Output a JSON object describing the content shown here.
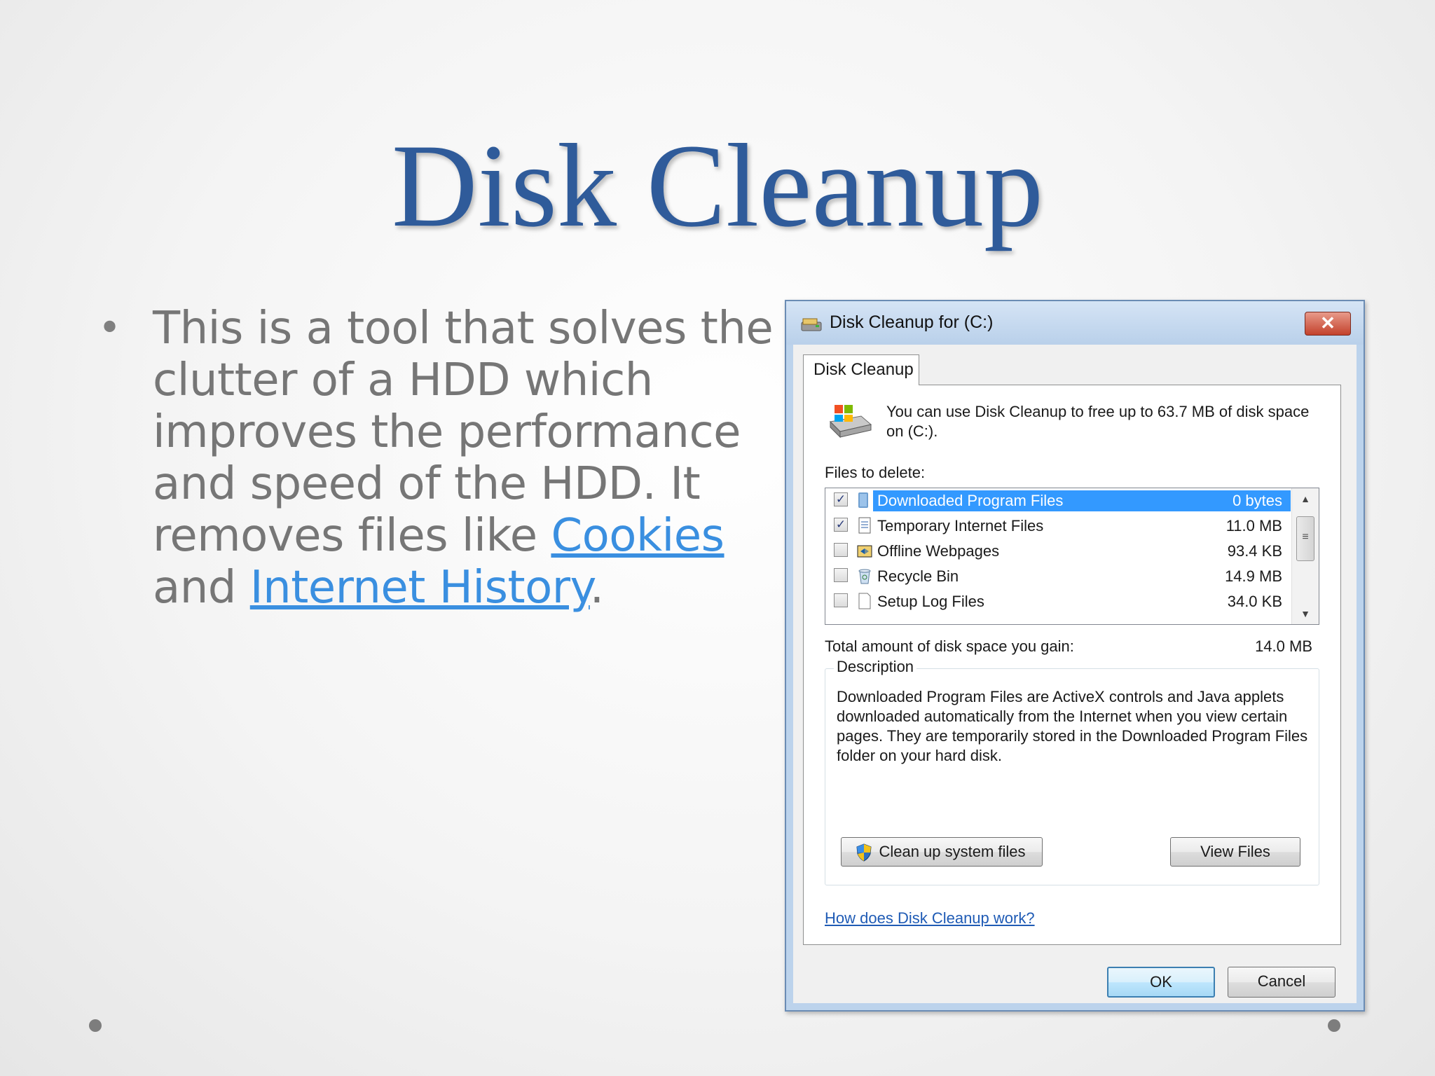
{
  "slide": {
    "title": "Disk Cleanup",
    "bullet": {
      "text_before": "This is a tool that solves the clutter of a HDD which improves the performance and speed of the HDD. It removes files like ",
      "link1": "Cookies",
      "text_between": " and ",
      "link2": "Internet History",
      "text_after": "."
    }
  },
  "dialog": {
    "title": "Disk Cleanup for  (C:)",
    "close_label": "✕",
    "tab_label": "Disk Cleanup",
    "intro": "You can use Disk Cleanup to free up to 63.7 MB of disk space on  (C:).",
    "files_label": "Files to delete:",
    "files": [
      {
        "name": "Downloaded Program Files",
        "size": "0 bytes",
        "checked": true,
        "selected": true,
        "icon": "folder-icon"
      },
      {
        "name": "Temporary Internet Files",
        "size": "11.0 MB",
        "checked": true,
        "selected": false,
        "icon": "document-icon"
      },
      {
        "name": "Offline Webpages",
        "size": "93.4 KB",
        "checked": false,
        "selected": false,
        "icon": "sync-folder-icon"
      },
      {
        "name": "Recycle Bin",
        "size": "14.9 MB",
        "checked": false,
        "selected": false,
        "icon": "recycle-bin-icon"
      },
      {
        "name": "Setup Log Files",
        "size": "34.0 KB",
        "checked": false,
        "selected": false,
        "icon": "blank-document-icon"
      }
    ],
    "check_mark": "✓",
    "total_label": "Total amount of disk space you gain:",
    "total_value": "14.0 MB",
    "description_legend": "Description",
    "description_text": "Downloaded Program Files are ActiveX controls and Java applets downloaded automatically from the Internet when you view certain pages. They are temporarily stored in the Downloaded Program Files folder on your hard disk.",
    "cleanup_button": "Clean up system files",
    "view_files_button": "View Files",
    "help_link": "How does Disk Cleanup work?",
    "ok_button": "OK",
    "cancel_button": "Cancel"
  },
  "colors": {
    "title": "#2f5b9a",
    "bullet_text": "#767676",
    "link": "#3a8fe0",
    "selection": "#3399ff"
  }
}
